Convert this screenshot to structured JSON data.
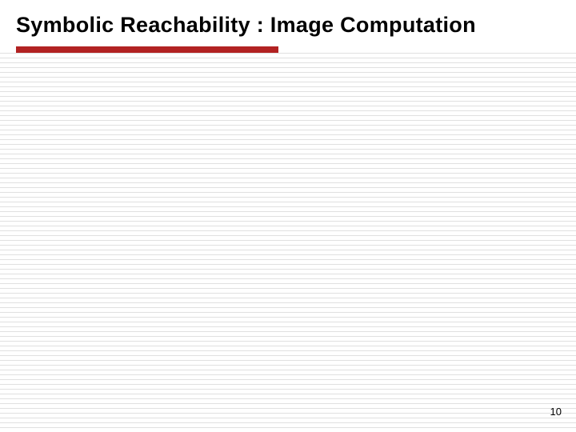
{
  "slide": {
    "title": "Symbolic Reachability : Image Computation",
    "page_number": "10"
  },
  "theme": {
    "accent_color": "#b22222",
    "title_color": "#000000",
    "background": "#ffffff",
    "line_color": "#e0e0e0"
  }
}
